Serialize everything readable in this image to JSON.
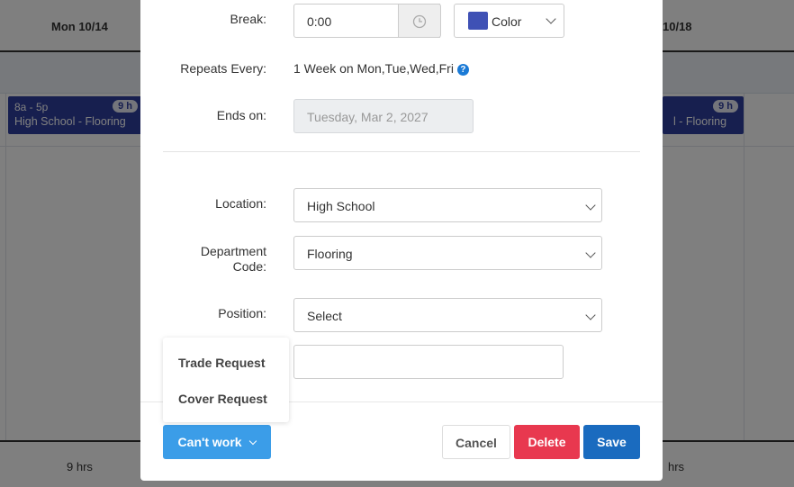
{
  "calendar": {
    "day_mon": "Mon 10/14",
    "day_fri_partial": "10/18",
    "shift_left": {
      "time": "8a - 5p",
      "location": "High School - Flooring",
      "hours": "9 h"
    },
    "shift_right": {
      "location": "l - Flooring",
      "hours": "9 h"
    },
    "footer_left": "9 hrs",
    "footer_right": "hrs"
  },
  "modal": {
    "break_label": "Break:",
    "break_value": "0:00",
    "color_label": "Color",
    "color_swatch": "#3f51b5",
    "repeats_label": "Repeats Every:",
    "repeats_value": "1 Week on Mon,Tue,Wed,Fri",
    "help_glyph": "?",
    "ends_label": "Ends on:",
    "ends_value": "Tuesday, Mar 2, 2027",
    "location_label": "Location:",
    "location_value": "High School",
    "department_label_line1": "Department",
    "department_label_line2": "Code:",
    "department_value": "Flooring",
    "position_label": "Position:",
    "position_value": "Select",
    "notes_value": "",
    "cant_work_label": "Can't work",
    "cancel_label": "Cancel",
    "delete_label": "Delete",
    "save_label": "Save"
  },
  "dropdown": {
    "items": [
      "Trade Request",
      "Cover Request"
    ]
  },
  "colors": {
    "primary": "#1a6bbf",
    "danger": "#e8384f",
    "cant_work": "#3b9de8",
    "shift": "#2f3e9e"
  }
}
